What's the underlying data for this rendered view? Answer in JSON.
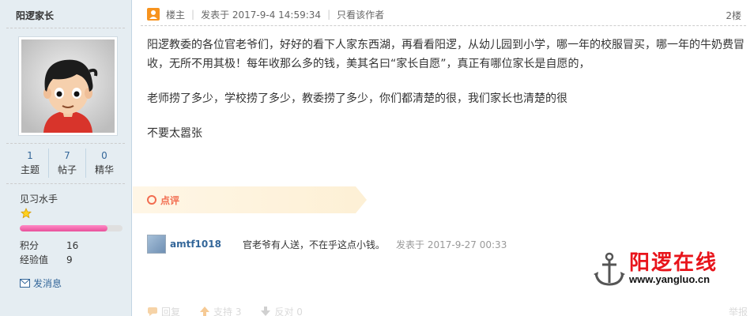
{
  "user": {
    "name": "阳逻家长",
    "stats": [
      {
        "num": "1",
        "label": "主题"
      },
      {
        "num": "7",
        "label": "帖子"
      },
      {
        "num": "0",
        "label": "精华"
      }
    ],
    "rank": "见习水手",
    "progress_fraction": 0.85,
    "points_label": "积分",
    "points_value": "16",
    "exp_label": "经验值",
    "exp_value": "9",
    "pm_label": "发消息"
  },
  "post": {
    "host_label": "楼主",
    "posted_at": "发表于 2017-9-4 14:59:34",
    "only_author": "只看该作者",
    "floor": "2楼",
    "paragraphs": [
      "阳逻教委的各位官老爷们，好好的看下人家东西湖，再看看阳逻，从幼儿园到小学，哪一年的校服冒买，哪一年的牛奶费冒收，无所不用其极！每年收那么多的钱，美其名曰“家长自愿”，真正有哪位家长是自愿的，",
      "老师捞了多少，学校捞了多少，教委捞了多少，你们都清楚的很，我们家长也清楚的很",
      "不要太嚣张"
    ]
  },
  "comments": {
    "header": "点评",
    "items": [
      {
        "user": "amtf1018",
        "text": "官老爷有人送，不在乎这点小钱。",
        "time": "发表于 2017-9-27 00:33"
      }
    ]
  },
  "logo": {
    "title": "阳逻在线",
    "url": "www.yangluo.cn"
  },
  "actions": {
    "reply": "回复",
    "support": "支持 3",
    "oppose": "反对 0",
    "report": "举报"
  },
  "colors": {
    "sidebar_bg": "#e5edf2",
    "link": "#336699",
    "comment_accent": "#f26c4f",
    "logo_red": "#e8141b"
  }
}
